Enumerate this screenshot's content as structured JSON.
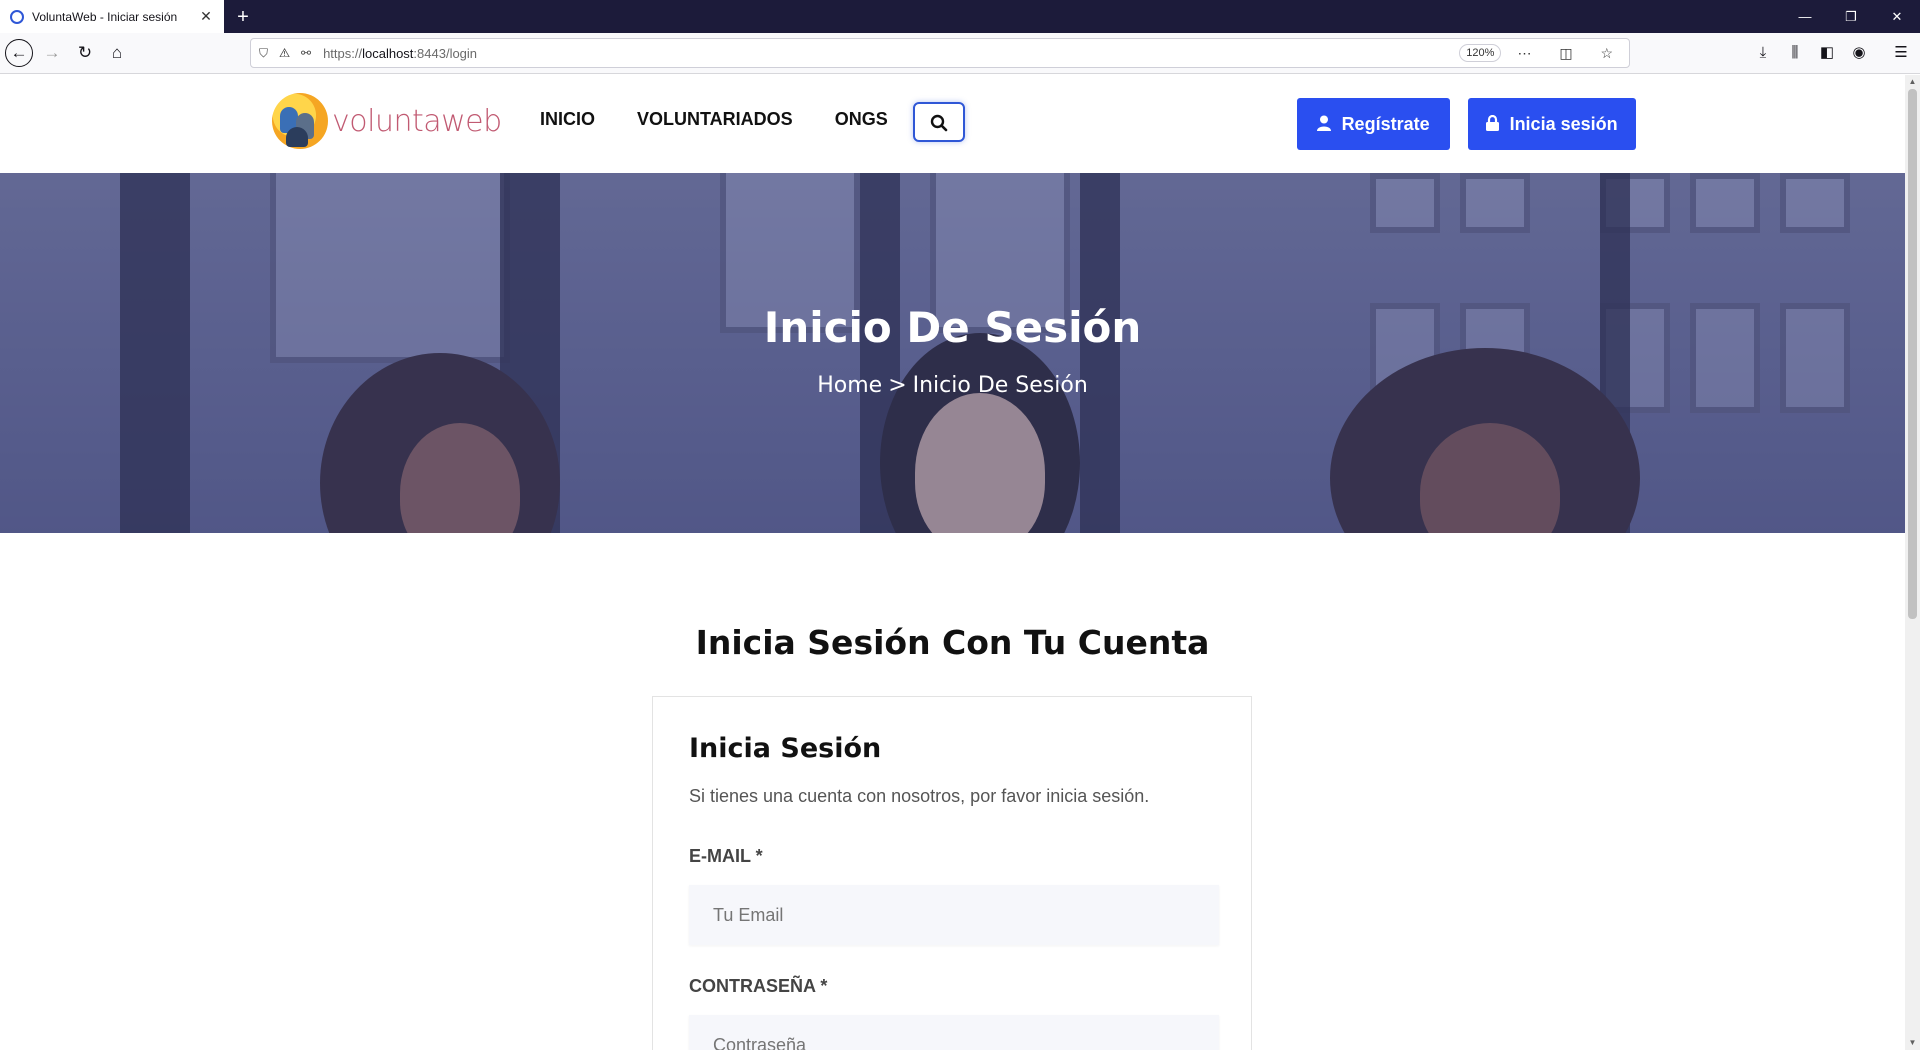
{
  "browser": {
    "tab_title": "VoluntaWeb - Iniciar sesión",
    "url_prefix": "https://",
    "url_host": "localhost",
    "url_rest": ":8443/login",
    "zoom": "120%"
  },
  "header": {
    "logo_text": "voluntaweb",
    "nav": [
      "INICIO",
      "VOLUNTARIADOS",
      "ONGS"
    ],
    "register_label": "Regístrate",
    "login_label": "Inicia sesión"
  },
  "hero": {
    "title": "Inicio De Sesión",
    "breadcrumb_home": "Home",
    "breadcrumb_sep": ">",
    "breadcrumb_current": "Inicio De Sesión"
  },
  "login": {
    "section_title": "Inicia Sesión Con Tu Cuenta",
    "card_title": "Inicia Sesión",
    "card_subtitle": "Si tienes una cuenta con nosotros, por favor inicia sesión.",
    "email_label": "E-MAIL *",
    "email_placeholder": "Tu Email",
    "password_label": "CONTRASEÑA *",
    "password_placeholder": "Contraseña"
  },
  "colors": {
    "primary": "#2a4ff0",
    "tabbar": "#1c1b3a",
    "logo_text": "#c15a72"
  },
  "icons": {
    "tab_favicon": "globe-icon",
    "search": "search-icon",
    "register": "user-icon",
    "login": "lock-icon"
  }
}
